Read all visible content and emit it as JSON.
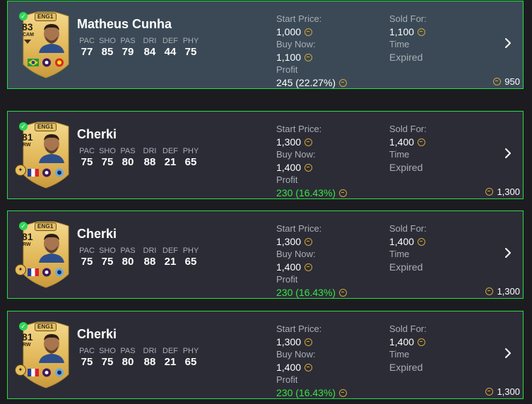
{
  "labels": {
    "start_price": "Start Price:",
    "buy_now": "Buy Now:",
    "profit": "Profit",
    "sold_for": "Sold For:",
    "time": "Time"
  },
  "stat_labels": [
    "PAC",
    "SHO",
    "PAS",
    "DRI",
    "DEF",
    "PHY"
  ],
  "colors": {
    "row_border": "#2ed84a",
    "profit_green": "#37e544",
    "coin_gold": "#d1a63a",
    "card_gold": "#e7be5e"
  },
  "items": [
    {
      "name": "Matheus Cunha",
      "rating": "83",
      "position": "CAM",
      "league": "ENG1",
      "stats": [
        "77",
        "85",
        "79",
        "84",
        "44",
        "75"
      ],
      "start_price": "1,000",
      "buy_now": "1,100",
      "profit": "245 (22.27%)",
      "profit_positive": false,
      "sold_for": "1,100",
      "time": "Expired",
      "bin_value": "950",
      "selected": true,
      "nation_icon": "brazil-flag",
      "league_icon": "premier-league-icon",
      "club_icon": "manchester-united-badge"
    },
    {
      "name": "Cherki",
      "rating": "81",
      "position": "RW",
      "league": "ENG1",
      "stats": [
        "75",
        "75",
        "80",
        "88",
        "21",
        "65"
      ],
      "start_price": "1,300",
      "buy_now": "1,400",
      "profit": "230 (16.43%)",
      "profit_positive": true,
      "sold_for": "1,400",
      "time": "Expired",
      "bin_value": "1,300",
      "selected": false,
      "nation_icon": "france-flag",
      "league_icon": "premier-league-icon",
      "club_icon": "manchester-city-badge"
    },
    {
      "name": "Cherki",
      "rating": "81",
      "position": "RW",
      "league": "ENG1",
      "stats": [
        "75",
        "75",
        "80",
        "88",
        "21",
        "65"
      ],
      "start_price": "1,300",
      "buy_now": "1,400",
      "profit": "230 (16.43%)",
      "profit_positive": true,
      "sold_for": "1,400",
      "time": "Expired",
      "bin_value": "1,300",
      "selected": false,
      "nation_icon": "france-flag",
      "league_icon": "premier-league-icon",
      "club_icon": "manchester-city-badge"
    },
    {
      "name": "Cherki",
      "rating": "81",
      "position": "RW",
      "league": "ENG1",
      "stats": [
        "75",
        "75",
        "80",
        "88",
        "21",
        "65"
      ],
      "start_price": "1,300",
      "buy_now": "1,400",
      "profit": "230 (16.43%)",
      "profit_positive": true,
      "sold_for": "1,400",
      "time": "Expired",
      "bin_value": "1,300",
      "selected": false,
      "nation_icon": "france-flag",
      "league_icon": "premier-league-icon",
      "club_icon": "manchester-city-badge"
    }
  ]
}
